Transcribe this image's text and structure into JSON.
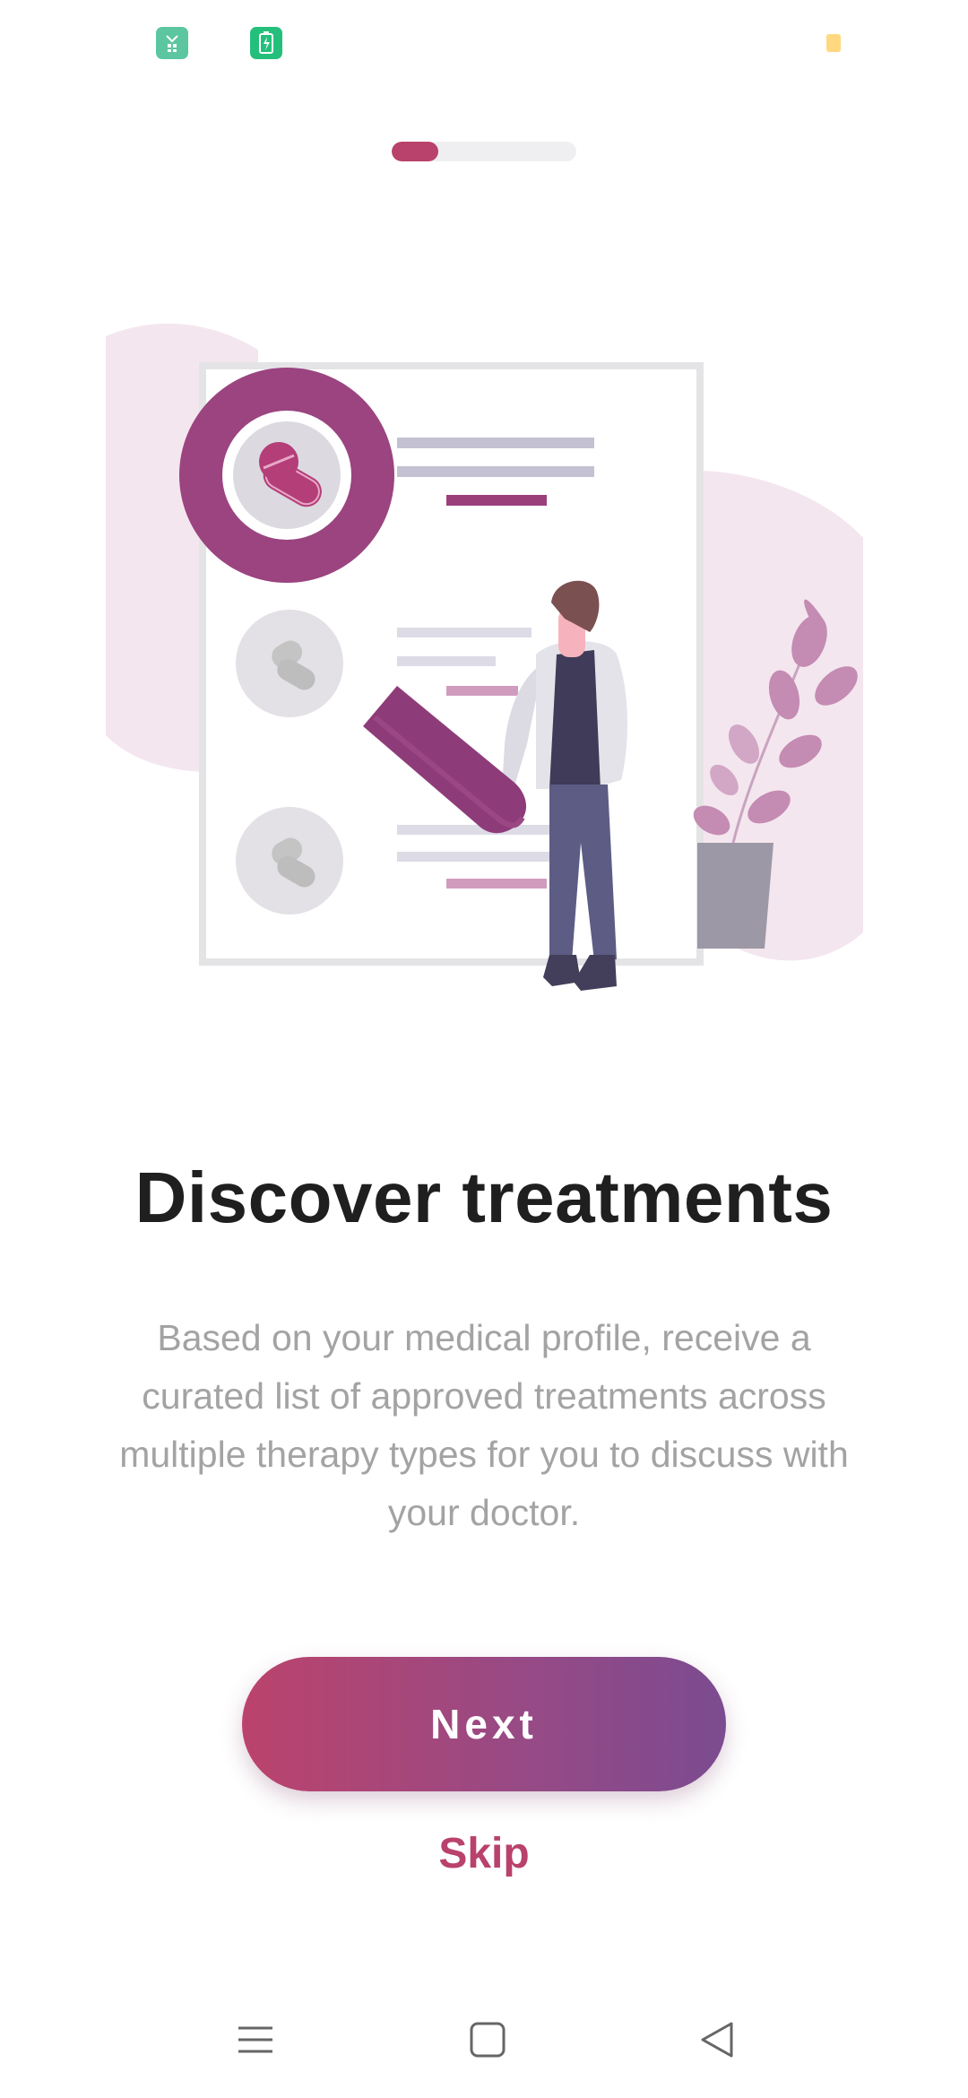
{
  "status_bar": {
    "icons": [
      "app-icon",
      "battery-saver-icon",
      "notification-dot"
    ]
  },
  "onboarding": {
    "progress": {
      "current_step": 1,
      "total_steps": 4,
      "fraction": 0.25
    },
    "illustration": "magnifier-treatment-list",
    "title": "Discover treatments",
    "description": "Based on your medical profile, receive a curated list of approved treatments across multiple therapy types for you to discuss with your doctor.",
    "next_label": "Next",
    "skip_label": "Skip"
  },
  "colors": {
    "accent": "#b9426d",
    "gradient_start": "#bb436c",
    "gradient_end": "#7b4b90",
    "title": "#1f1f1f",
    "description": "#a3a3a3"
  },
  "nav_bar": {
    "buttons": [
      "menu-icon",
      "home-icon",
      "back-icon"
    ]
  }
}
